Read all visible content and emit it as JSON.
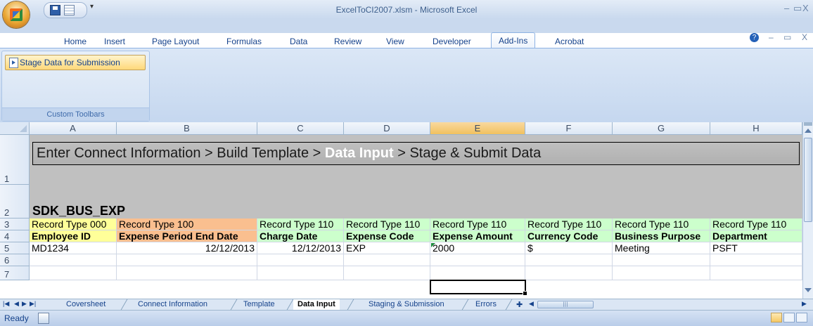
{
  "window": {
    "title": "ExcelToCI2007.xlsm - Microsoft Excel",
    "controls": [
      "–",
      "▭",
      "X"
    ],
    "mdi_controls": [
      "–",
      "▭",
      "X"
    ]
  },
  "ribbon_tabs": [
    {
      "label": "Home"
    },
    {
      "label": "Insert"
    },
    {
      "label": "Page Layout"
    },
    {
      "label": "Formulas"
    },
    {
      "label": "Data"
    },
    {
      "label": "Review"
    },
    {
      "label": "View"
    },
    {
      "label": "Developer"
    },
    {
      "label": "Add-Ins",
      "active": true
    },
    {
      "label": "Acrobat"
    }
  ],
  "ribbon": {
    "button_label": "Stage Data for Submission",
    "group_label": "Custom Toolbars",
    "help_icon": "?"
  },
  "columns": [
    "A",
    "B",
    "C",
    "D",
    "E",
    "F",
    "G",
    "H"
  ],
  "selected_column": "E",
  "rows": [
    "1",
    "2",
    "3",
    "4",
    "5",
    "6",
    "7"
  ],
  "banner": {
    "part1": "Enter Connect Information > Build Template > ",
    "highlight": "Data Input",
    "part2": " > Stage & Submit Data"
  },
  "record_name": "SDK_BUS_EXP",
  "row3": [
    "Record Type 000",
    "Record Type 100",
    "Record Type 110",
    "Record Type 110",
    "Record Type 110",
    "Record Type 110",
    "Record Type 110",
    "Record Type 110"
  ],
  "row4": [
    "Employee ID",
    "Expense Period End Date",
    "Charge Date",
    "Expense Code",
    "Expense Amount",
    "Currency Code",
    "Business Purpose",
    "Department"
  ],
  "row5": [
    "MD1234",
    "12/12/2013",
    "12/12/2013",
    "EXP",
    "2000",
    "$",
    "Meeting",
    "PSFT"
  ],
  "sheet_tabs": [
    {
      "label": "Coversheet"
    },
    {
      "label": "Connect Information"
    },
    {
      "label": "Template"
    },
    {
      "label": "Data Input",
      "active": true
    },
    {
      "label": "Staging & Submission"
    },
    {
      "label": "Errors"
    }
  ],
  "status": {
    "ready": "Ready"
  },
  "colors": {
    "yellow": "#ffff99",
    "orange": "#fabf8f",
    "green": "#ccffcc",
    "banner_grey": "#c0c0c0"
  }
}
